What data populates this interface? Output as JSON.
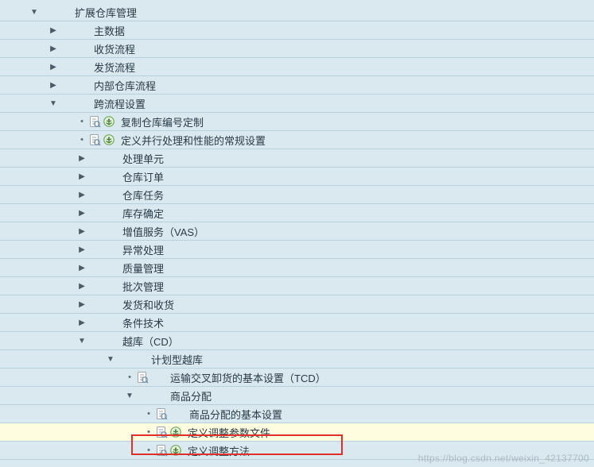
{
  "watermark": "https://blog.csdn.net/weixin_42137700",
  "nodes": [
    {
      "indent": 36,
      "expander": "down",
      "doc": false,
      "exec": false,
      "marker": "",
      "label": "扩展仓库管理",
      "interact": true
    },
    {
      "indent": 60,
      "expander": "right",
      "doc": false,
      "exec": false,
      "marker": "",
      "label": "主数据",
      "interact": true
    },
    {
      "indent": 60,
      "expander": "right",
      "doc": false,
      "exec": false,
      "marker": "",
      "label": "收货流程",
      "interact": true
    },
    {
      "indent": 60,
      "expander": "right",
      "doc": false,
      "exec": false,
      "marker": "",
      "label": "发货流程",
      "interact": true
    },
    {
      "indent": 60,
      "expander": "right",
      "doc": false,
      "exec": false,
      "marker": "",
      "label": "内部仓库流程",
      "interact": true
    },
    {
      "indent": 60,
      "expander": "down",
      "doc": false,
      "exec": false,
      "marker": "",
      "label": "跨流程设置",
      "interact": true
    },
    {
      "indent": 96,
      "expander": "",
      "doc": true,
      "exec": true,
      "marker": "dot",
      "label": "复制仓库编号定制",
      "interact": true
    },
    {
      "indent": 96,
      "expander": "",
      "doc": true,
      "exec": true,
      "marker": "dot",
      "label": "定义并行处理和性能的常规设置",
      "interact": true
    },
    {
      "indent": 96,
      "expander": "right",
      "doc": false,
      "exec": false,
      "marker": "",
      "label": "处理单元",
      "interact": true
    },
    {
      "indent": 96,
      "expander": "right",
      "doc": false,
      "exec": false,
      "marker": "",
      "label": "仓库订单",
      "interact": true
    },
    {
      "indent": 96,
      "expander": "right",
      "doc": false,
      "exec": false,
      "marker": "",
      "label": "仓库任务",
      "interact": true
    },
    {
      "indent": 96,
      "expander": "right",
      "doc": false,
      "exec": false,
      "marker": "",
      "label": "库存确定",
      "interact": true
    },
    {
      "indent": 96,
      "expander": "right",
      "doc": false,
      "exec": false,
      "marker": "",
      "label": "增值服务（VAS）",
      "interact": true
    },
    {
      "indent": 96,
      "expander": "right",
      "doc": false,
      "exec": false,
      "marker": "",
      "label": "异常处理",
      "interact": true
    },
    {
      "indent": 96,
      "expander": "right",
      "doc": false,
      "exec": false,
      "marker": "",
      "label": "质量管理",
      "interact": true
    },
    {
      "indent": 96,
      "expander": "right",
      "doc": false,
      "exec": false,
      "marker": "",
      "label": "批次管理",
      "interact": true
    },
    {
      "indent": 96,
      "expander": "right",
      "doc": false,
      "exec": false,
      "marker": "",
      "label": "发货和收货",
      "interact": true
    },
    {
      "indent": 96,
      "expander": "right",
      "doc": false,
      "exec": false,
      "marker": "",
      "label": "条件技术",
      "interact": true
    },
    {
      "indent": 96,
      "expander": "down",
      "doc": false,
      "exec": false,
      "marker": "",
      "label": "越库（CD）",
      "interact": true
    },
    {
      "indent": 132,
      "expander": "down",
      "doc": false,
      "exec": false,
      "marker": "",
      "label": "计划型越库",
      "interact": true
    },
    {
      "indent": 156,
      "expander": "",
      "doc": true,
      "exec": false,
      "marker": "dot",
      "label": "运输交叉卸货的基本设置（TCD）",
      "interact": true
    },
    {
      "indent": 156,
      "expander": "down",
      "doc": false,
      "exec": false,
      "marker": "",
      "label": "商品分配",
      "interact": true
    },
    {
      "indent": 180,
      "expander": "",
      "doc": true,
      "exec": false,
      "marker": "dot",
      "label": "商品分配的基本设置",
      "interact": true
    },
    {
      "indent": 180,
      "expander": "",
      "doc": true,
      "exec": true,
      "marker": "dot",
      "label": "定义调整参数文件",
      "interact": true,
      "highlight": true
    },
    {
      "indent": 180,
      "expander": "",
      "doc": true,
      "exec": true,
      "marker": "dot",
      "label": "定义调整方法",
      "interact": true
    }
  ]
}
